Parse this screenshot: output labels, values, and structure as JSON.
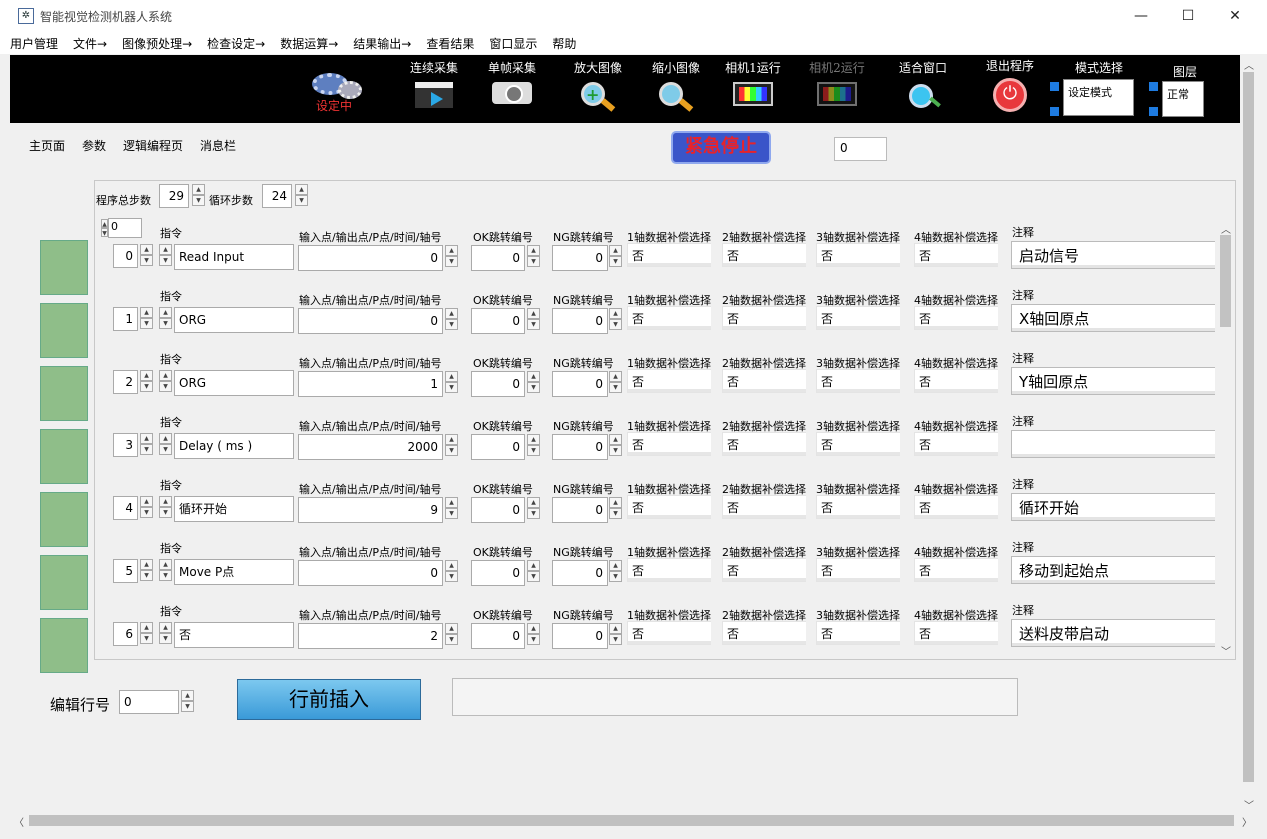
{
  "window": {
    "title": "智能视觉检测机器人系统",
    "minimize": "—",
    "maximize": "☐",
    "close": "✕"
  },
  "menu": [
    "用户管理",
    "文件→",
    "图像预处理→",
    "检查设定→",
    "数据运算→",
    "结果输出→",
    "查看结果",
    "窗口显示",
    "帮助"
  ],
  "toolbar": {
    "status": "设定中",
    "buttons": [
      {
        "label": "连续采集",
        "icon": "clapperboard-play-icon"
      },
      {
        "label": "单帧采集",
        "icon": "camera-icon"
      },
      {
        "label": "放大图像",
        "icon": "zoom-in-icon"
      },
      {
        "label": "缩小图像",
        "icon": "zoom-out-icon"
      },
      {
        "label": "相机1运行",
        "icon": "monitor-icon"
      },
      {
        "label": "相机2运行",
        "icon": "monitor-icon",
        "disabled": true
      },
      {
        "label": "适合窗口",
        "icon": "fit-window-icon"
      },
      {
        "label": "退出程序",
        "icon": "power-icon"
      }
    ],
    "mode_label": "模式选择",
    "mode_value": "设定模式",
    "layer_label": "图层",
    "layer_value": "正常"
  },
  "tabs": [
    "主页面",
    "参数",
    "逻辑编程页",
    "消息栏"
  ],
  "estop_label": "紧急停止",
  "top_value": "0",
  "program": {
    "total_label": "程序总步数",
    "total_value": "29",
    "loop_label": "循环步数",
    "loop_value": "24",
    "start_index": "0"
  },
  "col_labels": {
    "cmd": "指令",
    "io": "输入点/输出点/P点/时间/轴号",
    "ok": "OK跳转编号",
    "ng": "NG跳转编号",
    "a1": "1轴数据补偿选择",
    "a2": "2轴数据补偿选择",
    "a3": "3轴数据补偿选择",
    "a4": "4轴数据补偿选择",
    "note": "注释"
  },
  "rows": [
    {
      "idx": "0",
      "cmd": "Read Input",
      "io": "0",
      "ok": "0",
      "ng": "0",
      "a1": "否",
      "a2": "否",
      "a3": "否",
      "a4": "否",
      "note": "启动信号"
    },
    {
      "idx": "1",
      "cmd": "ORG",
      "io": "0",
      "ok": "0",
      "ng": "0",
      "a1": "否",
      "a2": "否",
      "a3": "否",
      "a4": "否",
      "note": "X轴回原点"
    },
    {
      "idx": "2",
      "cmd": "ORG",
      "io": "1",
      "ok": "0",
      "ng": "0",
      "a1": "否",
      "a2": "否",
      "a3": "否",
      "a4": "否",
      "note": "Y轴回原点"
    },
    {
      "idx": "3",
      "cmd": "Delay ( ms )",
      "io": "2000",
      "ok": "0",
      "ng": "0",
      "a1": "否",
      "a2": "否",
      "a3": "否",
      "a4": "否",
      "note": ""
    },
    {
      "idx": "4",
      "cmd": "循环开始",
      "io": "9",
      "ok": "0",
      "ng": "0",
      "a1": "否",
      "a2": "否",
      "a3": "否",
      "a4": "否",
      "note": "循环开始"
    },
    {
      "idx": "5",
      "cmd": "Move P点",
      "io": "0",
      "ok": "0",
      "ng": "0",
      "a1": "否",
      "a2": "否",
      "a3": "否",
      "a4": "否",
      "note": "移动到起始点"
    },
    {
      "idx": "6",
      "cmd": "否",
      "io": "2",
      "ok": "0",
      "ng": "0",
      "a1": "否",
      "a2": "否",
      "a3": "否",
      "a4": "否",
      "note": "送料皮带启动"
    }
  ],
  "edit": {
    "label": "编辑行号",
    "value": "0",
    "insert_label": "行前插入"
  }
}
